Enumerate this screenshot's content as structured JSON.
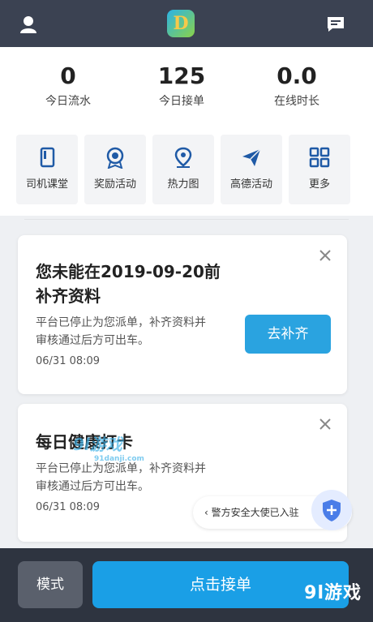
{
  "header": {
    "logo_letter": "D"
  },
  "stats": [
    {
      "value": "0",
      "label": "今日流水"
    },
    {
      "value": "125",
      "label": "今日接单"
    },
    {
      "value": "0.0",
      "label": "在线时长"
    }
  ],
  "menu": [
    {
      "label": "司机课堂",
      "icon": "book-icon"
    },
    {
      "label": "奖励活动",
      "icon": "medal-icon"
    },
    {
      "label": "热力图",
      "icon": "location-pin-icon"
    },
    {
      "label": "高德活动",
      "icon": "paper-plane-icon"
    },
    {
      "label": "更多",
      "icon": "grid-icon"
    }
  ],
  "cards": [
    {
      "title_line1": "您未能在2019-09-20前",
      "title_line2": "补齐资料",
      "desc_line1": "平台已停止为您派单，补齐资料并",
      "desc_line2": "审核通过后方可出车。",
      "time": "06/31 08:09",
      "action": "去补齐"
    },
    {
      "title_line1": "每日健康打卡",
      "desc_line1": "平台已停止为您派单，补齐资料并",
      "desc_line2": "审核通过后方可出车。",
      "time": "06/31 08:09"
    }
  ],
  "police_banner": "警方安全大使已入驻",
  "bottom": {
    "mode": "模式",
    "accept": "点击接单"
  },
  "watermark": {
    "brand": "9l游戏",
    "site": "91danji.com"
  },
  "colors": {
    "topbar": "#3b4252",
    "accent": "#1a9fe6",
    "bottombar": "#2e3440"
  }
}
